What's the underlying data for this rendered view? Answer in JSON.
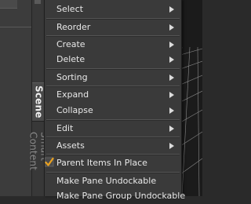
{
  "menu": {
    "items": [
      {
        "label": "Select",
        "submenu": true
      },
      {
        "label": "Reorder",
        "submenu": true
      },
      {
        "label": "Create",
        "submenu": true
      },
      {
        "label": "Delete",
        "submenu": true
      },
      {
        "label": "Sorting",
        "submenu": true
      },
      {
        "label": "Expand",
        "submenu": true
      },
      {
        "label": "Collapse",
        "submenu": true
      },
      {
        "label": "Edit",
        "submenu": true
      },
      {
        "label": "Assets",
        "submenu": true
      },
      {
        "label": "Parent Items In Place",
        "submenu": false,
        "checked": true
      },
      {
        "label": "Make Pane Undockable",
        "submenu": false
      },
      {
        "label": "Make Pane Group Undockable",
        "submenu": false
      }
    ]
  },
  "tabs": {
    "active": "Scene",
    "next": "Smart Content"
  },
  "colors": {
    "menu_bg": "#3a3a3a",
    "text": "#e8e8e8",
    "check_accent": "#e8a020"
  }
}
